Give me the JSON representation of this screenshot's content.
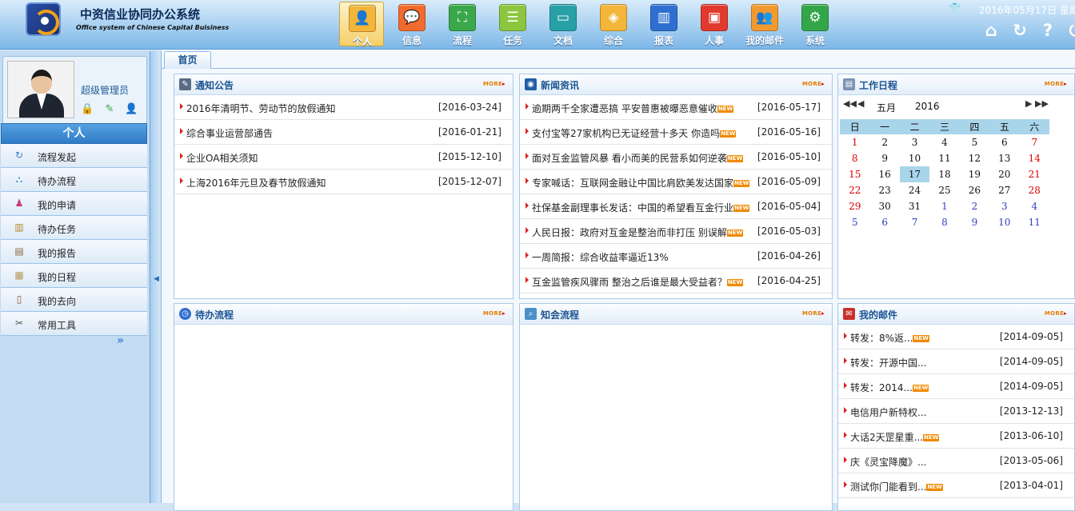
{
  "app": {
    "title": "中资信业协同办公系统",
    "subtitle": "Office system of Chinese Capital Buisiness",
    "date": "2016年05月17日 星期"
  },
  "nav": [
    {
      "label": "个人",
      "icon": "person-icon",
      "color": "#f3b53a",
      "active": true
    },
    {
      "label": "信息",
      "icon": "message-icon",
      "color": "#f26b2e"
    },
    {
      "label": "流程",
      "icon": "flowchart-icon",
      "color": "#3aa84a"
    },
    {
      "label": "任务",
      "icon": "task-icon",
      "color": "#8cc63f"
    },
    {
      "label": "文档",
      "icon": "folder-icon",
      "color": "#27a0a6"
    },
    {
      "label": "综合",
      "icon": "general-icon",
      "color": "#f3b53a"
    },
    {
      "label": "报表",
      "icon": "bar-chart-icon",
      "color": "#2f6fd1"
    },
    {
      "label": "人事",
      "icon": "id-card-icon",
      "color": "#e03a2e"
    },
    {
      "label": "我的邮件",
      "icon": "people-icon",
      "color": "#f39a2e"
    },
    {
      "label": "系统",
      "icon": "gear-icon",
      "color": "#34a64a"
    }
  ],
  "toolbar": {
    "icons": [
      "shirt-icon",
      "home-icon",
      "refresh-icon",
      "help-icon",
      "power-icon"
    ]
  },
  "user": {
    "name": "超级管理员"
  },
  "sidebar": {
    "section": "个人",
    "items": [
      {
        "label": "流程发起",
        "icon": "flow-start-icon"
      },
      {
        "label": "待办流程",
        "icon": "pending-flow-icon"
      },
      {
        "label": "我的申请",
        "icon": "application-icon"
      },
      {
        "label": "待办任务",
        "icon": "pending-task-icon"
      },
      {
        "label": "我的报告",
        "icon": "report-icon"
      },
      {
        "label": "我的日程",
        "icon": "schedule-icon"
      },
      {
        "label": "我的去向",
        "icon": "whereabouts-icon"
      },
      {
        "label": "常用工具",
        "icon": "tools-icon"
      }
    ],
    "expand": "»"
  },
  "tabs": [
    {
      "label": "首页"
    }
  ],
  "more_label": "MORE",
  "new_badge": "NEW",
  "notice": {
    "title": "通知公告",
    "rows": [
      {
        "text": "2016年清明节、劳动节的放假通知",
        "date": "[2016-03-24]",
        "new": false
      },
      {
        "text": "综合事业运营部通告",
        "date": "[2016-01-21]",
        "new": false
      },
      {
        "text": "企业OA相关须知",
        "date": "[2015-12-10]",
        "new": false
      },
      {
        "text": "上海2016年元旦及春节放假通知",
        "date": "[2015-12-07]",
        "new": false
      }
    ]
  },
  "news": {
    "title": "新闻资讯",
    "rows": [
      {
        "text": "逾期两千全家遭恶搞 平安普惠被曝恶意催收",
        "date": "[2016-05-17]",
        "new": true
      },
      {
        "text": "支付宝等27家机构已无证经营十多天 你造吗",
        "date": "[2016-05-16]",
        "new": true
      },
      {
        "text": "面对互金监管风暴 看小而美的民营系如何逆袭",
        "date": "[2016-05-10]",
        "new": true
      },
      {
        "text": "专家喊话：互联网金融让中国比肩欧美发达国家",
        "date": "[2016-05-09]",
        "new": true
      },
      {
        "text": "社保基金副理事长发话：中国的希望看互金行业",
        "date": "[2016-05-04]",
        "new": true
      },
      {
        "text": "人民日报：政府对互金是整治而非打压 别误解",
        "date": "[2016-05-03]",
        "new": true
      },
      {
        "text": "一周简报：综合收益率逼近13%",
        "date": "[2016-04-26]",
        "new": false
      },
      {
        "text": "互金监管疾风骤雨 整治之后谁是最大受益者？",
        "date": "[2016-04-25]",
        "new": true
      }
    ]
  },
  "schedule": {
    "title": "工作日程",
    "month": "五月",
    "year": "2016",
    "weekdays": [
      "日",
      "一",
      "二",
      "三",
      "四",
      "五",
      "六"
    ],
    "weeks": [
      [
        {
          "d": "1",
          "t": "wk"
        },
        {
          "d": "2"
        },
        {
          "d": "3"
        },
        {
          "d": "4"
        },
        {
          "d": "5"
        },
        {
          "d": "6"
        },
        {
          "d": "7",
          "t": "wk"
        }
      ],
      [
        {
          "d": "8",
          "t": "wk"
        },
        {
          "d": "9"
        },
        {
          "d": "10"
        },
        {
          "d": "11"
        },
        {
          "d": "12"
        },
        {
          "d": "13"
        },
        {
          "d": "14",
          "t": "wk"
        }
      ],
      [
        {
          "d": "15",
          "t": "wk"
        },
        {
          "d": "16"
        },
        {
          "d": "17",
          "t": "today"
        },
        {
          "d": "18"
        },
        {
          "d": "19"
        },
        {
          "d": "20"
        },
        {
          "d": "21",
          "t": "wk"
        }
      ],
      [
        {
          "d": "22",
          "t": "wk"
        },
        {
          "d": "23"
        },
        {
          "d": "24"
        },
        {
          "d": "25"
        },
        {
          "d": "26"
        },
        {
          "d": "27"
        },
        {
          "d": "28",
          "t": "wk"
        }
      ],
      [
        {
          "d": "29",
          "t": "wk"
        },
        {
          "d": "30"
        },
        {
          "d": "31"
        },
        {
          "d": "1",
          "t": "oth"
        },
        {
          "d": "2",
          "t": "oth"
        },
        {
          "d": "3",
          "t": "oth"
        },
        {
          "d": "4",
          "t": "oth"
        }
      ],
      [
        {
          "d": "5",
          "t": "oth"
        },
        {
          "d": "6",
          "t": "oth"
        },
        {
          "d": "7",
          "t": "oth"
        },
        {
          "d": "8",
          "t": "oth"
        },
        {
          "d": "9",
          "t": "oth"
        },
        {
          "d": "10",
          "t": "oth"
        },
        {
          "d": "11",
          "t": "oth"
        }
      ]
    ]
  },
  "pending": {
    "title": "待办流程"
  },
  "cc": {
    "title": "知会流程"
  },
  "mail": {
    "title": "我的邮件",
    "rows": [
      {
        "text": "转发：8%返...",
        "date": "[2014-09-05]",
        "new": true
      },
      {
        "text": "转发：开源中国...",
        "date": "[2014-09-05]",
        "new": false
      },
      {
        "text": "转发：2014...",
        "date": "[2014-09-05]",
        "new": true
      },
      {
        "text": "电信用户新特权...",
        "date": "[2013-12-13]",
        "new": false
      },
      {
        "text": "大话2天罡星重...",
        "date": "[2013-06-10]",
        "new": true
      },
      {
        "text": "庆《灵宝降魔》...",
        "date": "[2013-05-06]",
        "new": false
      },
      {
        "text": "测试你门能看到...",
        "date": "[2013-04-01]",
        "new": true
      }
    ]
  }
}
